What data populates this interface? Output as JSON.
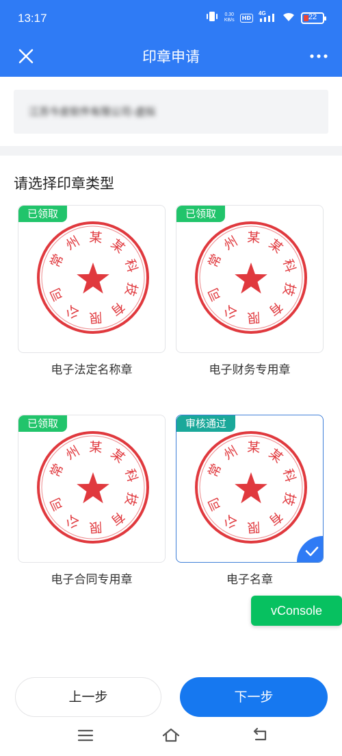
{
  "status_bar": {
    "time": "13:17",
    "net_speed_value": "0.30",
    "net_speed_unit": "KB/s",
    "hd_label": "HD",
    "network_label": "4G",
    "battery_level": "22"
  },
  "header": {
    "title": "印章申请",
    "close_icon": "close-icon",
    "more_icon": "more-icon"
  },
  "company": {
    "name": "江苏今皮软件有限公司-虚拟"
  },
  "section": {
    "title": "请选择印章类型"
  },
  "seal_image": {
    "ring_text": "常州某某科技有限公司",
    "color": "#e0393e"
  },
  "seals": [
    {
      "status": "已领取",
      "label": "电子法定名称章",
      "selected": false
    },
    {
      "status": "已领取",
      "label": "电子财务专用章",
      "selected": false
    },
    {
      "status": "已领取",
      "label": "电子合同专用章",
      "selected": false
    },
    {
      "status": "审核通过",
      "label": "电子名章",
      "selected": true
    }
  ],
  "vconsole": {
    "label": "vConsole"
  },
  "actions": {
    "prev_label": "上一步",
    "next_label": "下一步"
  },
  "colors": {
    "header": "#2f7bf5",
    "badge_received": "#21c46b",
    "badge_approved": "#1aa89a",
    "primary_button": "#1678f0",
    "vconsole": "#07c160"
  }
}
